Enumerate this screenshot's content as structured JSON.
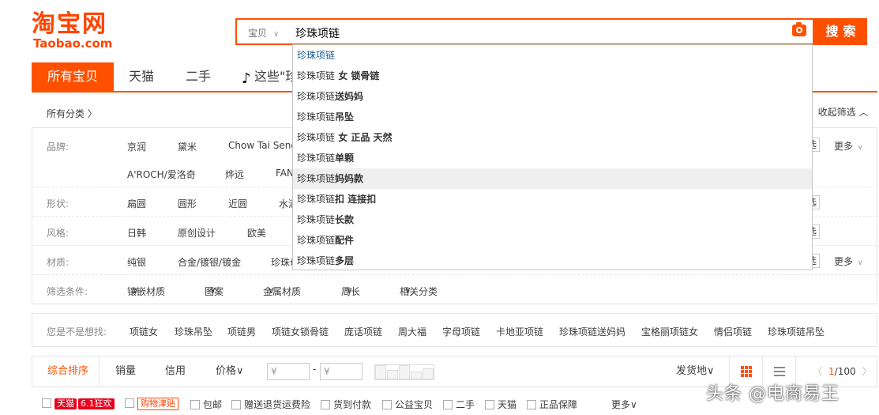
{
  "logo": {
    "cn": "淘宝网",
    "en": "Taobao.com"
  },
  "search": {
    "type": "宝贝",
    "query": "珍珠项链",
    "button": "搜索"
  },
  "suggestions": [
    {
      "prefix": "珍珠项链",
      "suffix": ""
    },
    {
      "prefix": "珍珠项链",
      "suffix": " 女 锁骨链"
    },
    {
      "prefix": "珍珠项链",
      "suffix": "送妈妈"
    },
    {
      "prefix": "珍珠项链",
      "suffix": "吊坠"
    },
    {
      "prefix": "珍珠项链",
      "suffix": " 女 正品 天然"
    },
    {
      "prefix": "珍珠项链",
      "suffix": "单颗"
    },
    {
      "prefix": "珍珠项链",
      "suffix": "妈妈款"
    },
    {
      "prefix": "珍珠项链",
      "suffix": "扣 连接扣"
    },
    {
      "prefix": "珍珠项链",
      "suffix": "长款"
    },
    {
      "prefix": "珍珠项链",
      "suffix": "配件"
    },
    {
      "prefix": "珍珠项链",
      "suffix": "多层"
    }
  ],
  "tabs": [
    "所有宝贝",
    "天猫",
    "二手",
    "这些\"珍"
  ],
  "catbar": {
    "all": "所有分类 〉",
    "collapse": "收起筛选 ︿"
  },
  "filters": {
    "brand": {
      "label": "品牌:",
      "row1": [
        "京润",
        "黛米",
        "Chow Tai Seng"
      ],
      "row2": [
        "A'ROCH/爱洛奇",
        "烨远",
        "FAN"
      ],
      "more": "更多",
      "multi": "选"
    },
    "shape": {
      "label": "形状:",
      "values": [
        "扁圆",
        "圆形",
        "近圆",
        "水滴"
      ],
      "multi": "选"
    },
    "style": {
      "label": "风格:",
      "values": [
        "日韩",
        "原创设计",
        "欧美"
      ],
      "multi": "选"
    },
    "material": {
      "label": "材质:",
      "values": [
        "纯银",
        "合金/镀银/镀金",
        "珍珠母"
      ],
      "more": "更多",
      "multi": "选"
    },
    "conditions": {
      "label": "筛选条件:",
      "values": [
        "镶嵌材质",
        "图案",
        "金属材质",
        "周长",
        "相关分类"
      ]
    }
  },
  "suggest_bar": {
    "label": "您是不是想找:",
    "keywords": [
      "项链女",
      "珍珠吊坠",
      "项链男",
      "项链女锁骨链",
      "庞话项链",
      "周大福",
      "字母项链",
      "卡地亚项链",
      "珍珠项链送妈妈",
      "宝格丽项链女",
      "情侣项链",
      "珍珠项链吊坠"
    ]
  },
  "sortbar": {
    "sorts": [
      "综合排序",
      "销量",
      "信用",
      "价格"
    ],
    "price_min": "¥",
    "price_max": "¥",
    "dash": "-",
    "ship": "发货地",
    "page_cur": "1",
    "page_total": "/100"
  },
  "checkbar": {
    "tmall": "天猫",
    "promo": "6.1狂欢",
    "subsidy": "购物津贴",
    "items": [
      "包邮",
      "赠送退货运费险",
      "货到付款",
      "公益宝贝",
      "二手",
      "天猫",
      "正品保障"
    ],
    "more": "更多"
  },
  "watermark": "头条 @电商易王"
}
